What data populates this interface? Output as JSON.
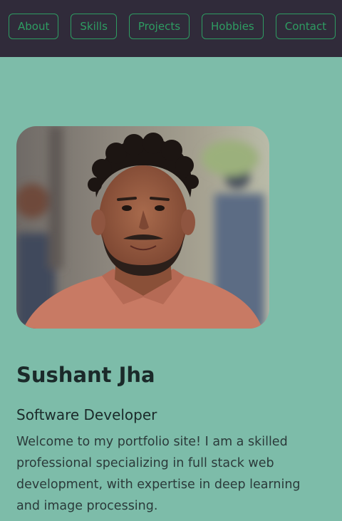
{
  "nav": {
    "items": [
      {
        "label": "About"
      },
      {
        "label": "Skills"
      },
      {
        "label": "Projects"
      },
      {
        "label": "Hobbies"
      },
      {
        "label": "Contact"
      }
    ]
  },
  "profile": {
    "name": "Sushant Jha",
    "role": "Software Developer",
    "intro": "Welcome to my portfolio site! I am a skilled professional specializing in full stack web development, with expertise in deep learning and image processing."
  },
  "colors": {
    "page_bg": "#7dbca9",
    "nav_bg": "#302b3a",
    "nav_accent": "#2e9c62"
  }
}
